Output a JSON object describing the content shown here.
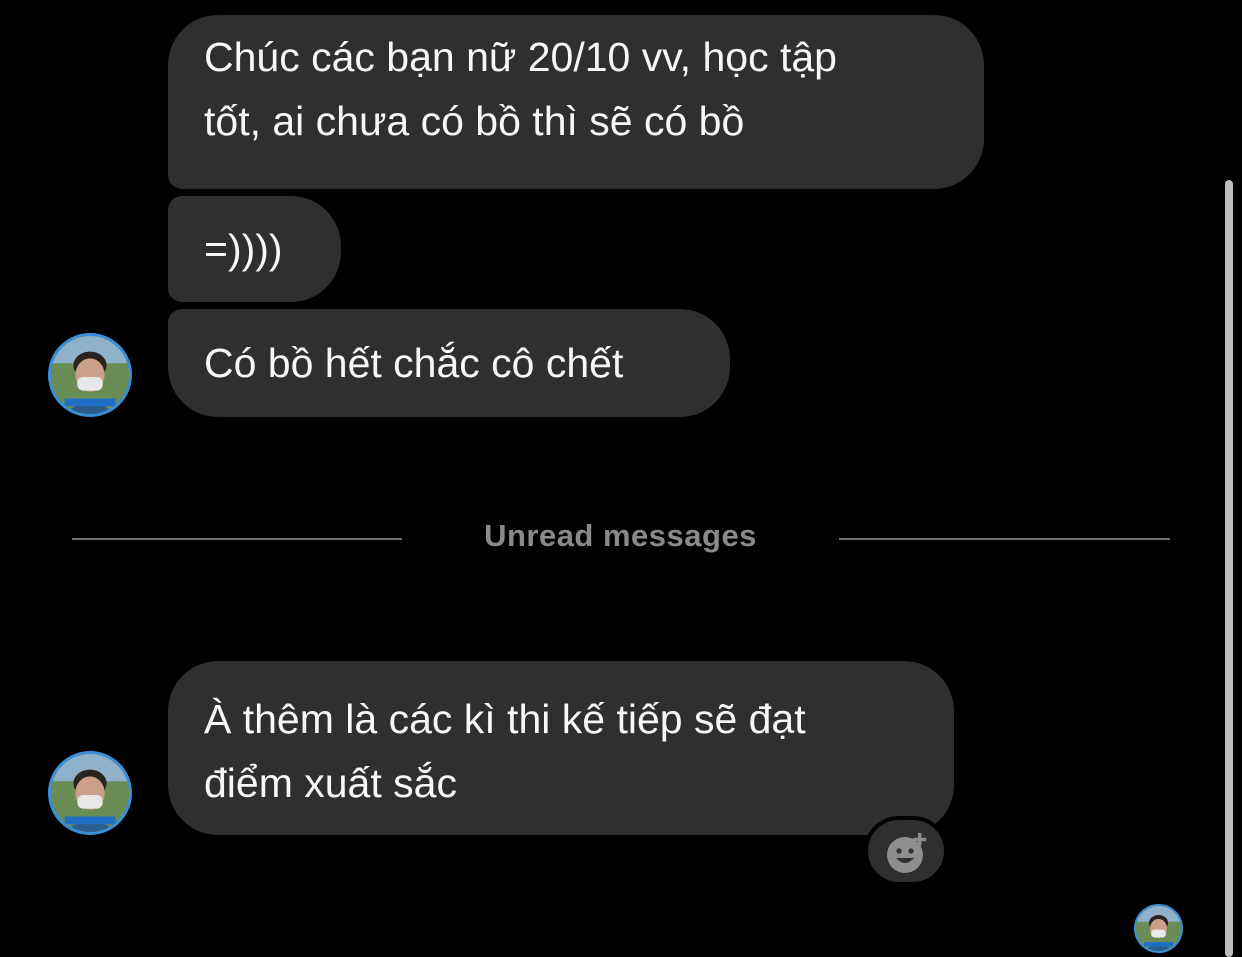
{
  "messages": [
    {
      "lines": [
        "Chúc các bạn nữ 20/10 vv, học tập",
        "tốt, ai chưa có bồ thì sẽ có bồ"
      ]
    },
    {
      "lines": [
        "=))))"
      ]
    },
    {
      "lines": [
        "Có bồ hết chắc cô chết"
      ]
    },
    {
      "lines": [
        "À thêm là các kì thi kế tiếp sẽ đạt",
        "điểm xuất sắc"
      ]
    }
  ],
  "divider": {
    "label": "Unread messages"
  },
  "icons": {
    "avatar": "sender-avatar",
    "reaction": "add-reaction-smiley-icon",
    "read_receipt": "seen-avatar"
  },
  "colors": {
    "background": "#000000",
    "bubble": "#2f2f2f",
    "text": "#f7f7f7",
    "divider_text": "#8a8a8a",
    "avatar_ring": "#3a8fd9"
  }
}
